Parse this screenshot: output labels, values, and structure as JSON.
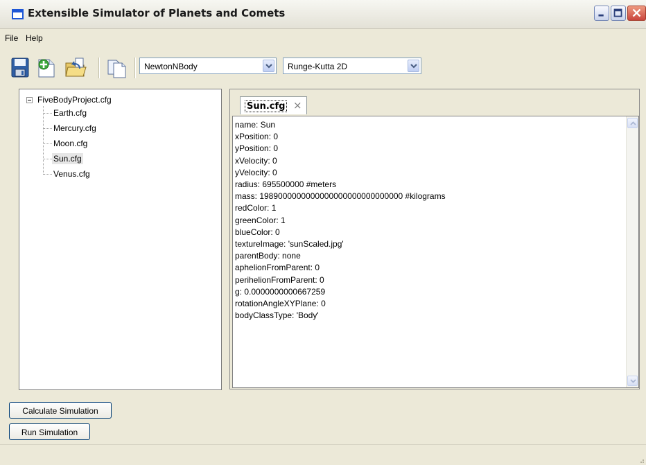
{
  "window": {
    "title": "Extensible Simulator of Planets and Comets"
  },
  "menubar": {
    "items": [
      "File",
      "Help"
    ]
  },
  "toolbar": {
    "icons": [
      "save-icon",
      "new-file-icon",
      "open-folder-icon",
      "copy-icon"
    ],
    "physics_model": "NewtonNBody",
    "integrator": "Runge-Kutta 2D"
  },
  "tree": {
    "root": "FiveBodyProject.cfg",
    "children": [
      "Earth.cfg",
      "Mercury.cfg",
      "Moon.cfg",
      "Sun.cfg",
      "Venus.cfg"
    ],
    "selected": "Sun.cfg"
  },
  "editor": {
    "tab_label": "Sun.cfg",
    "tab_close": "×",
    "lines": [
      "name: Sun",
      "xPosition: 0",
      "yPosition: 0",
      "xVelocity: 0",
      "yVelocity: 0",
      "radius: 695500000 #meters",
      "mass: 1989000000000000000000000000000 #kilograms",
      "redColor: 1",
      "greenColor: 1",
      "blueColor: 0",
      "textureImage: 'sunScaled.jpg'",
      "parentBody: none",
      "aphelionFromParent: 0",
      "perihelionFromParent: 0",
      "g: 0.0000000000667259",
      "rotationAngleXYPlane: 0",
      "bodyClassType: 'Body'"
    ]
  },
  "buttons": {
    "calculate": "Calculate Simulation",
    "run": "Run Simulation"
  }
}
